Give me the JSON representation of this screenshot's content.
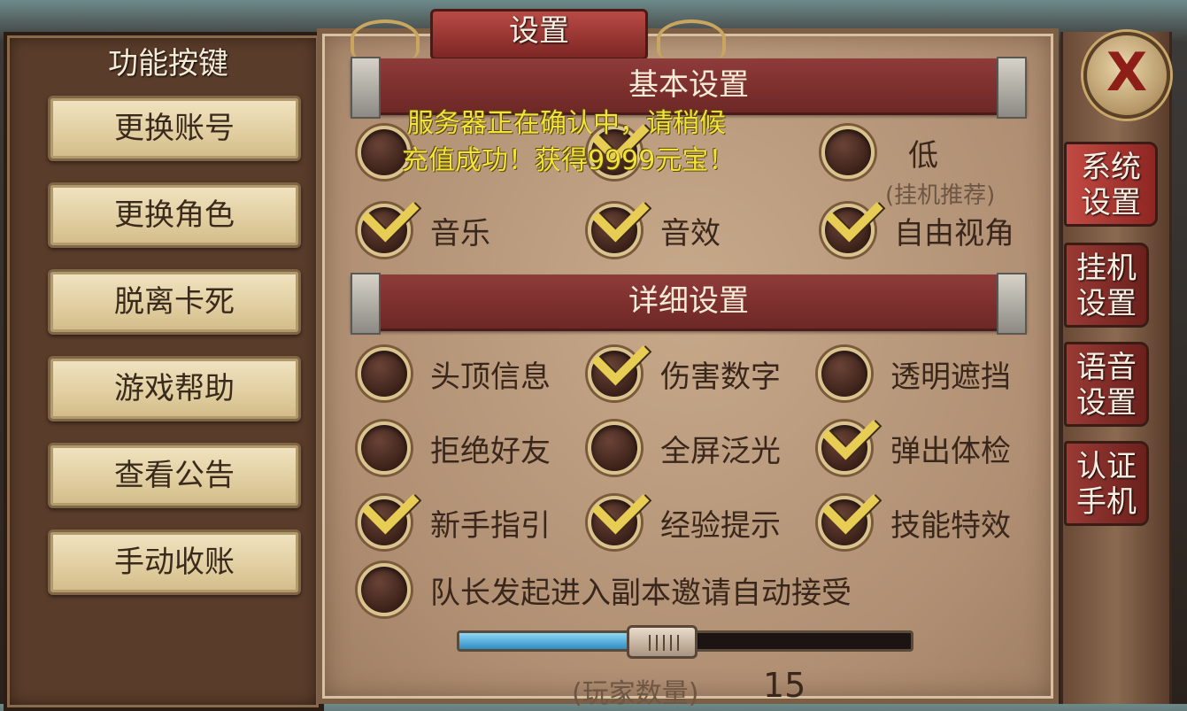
{
  "window": {
    "title": "设置"
  },
  "left_panel": {
    "title": "功能按键",
    "buttons": [
      "更换账号",
      "更换角色",
      "脱离卡死",
      "游戏帮助",
      "查看公告",
      "手动收账"
    ]
  },
  "notices": [
    "服务器正在确认中，请稍候",
    "充值成功！获得9999元宝！"
  ],
  "basic": {
    "header": "基本设置",
    "quality_low_label": "低",
    "quality_low_hint": "(挂机推荐)",
    "options": [
      {
        "label": "音乐",
        "checked": true
      },
      {
        "label": "音效",
        "checked": true
      },
      {
        "label": "自由视角",
        "checked": true
      }
    ]
  },
  "detail": {
    "header": "详细设置",
    "options": [
      {
        "label": "头顶信息",
        "checked": false
      },
      {
        "label": "伤害数字",
        "checked": true
      },
      {
        "label": "透明遮挡",
        "checked": false
      },
      {
        "label": "拒绝好友",
        "checked": false
      },
      {
        "label": "全屏泛光",
        "checked": false
      },
      {
        "label": "弹出体检",
        "checked": true
      },
      {
        "label": "新手指引",
        "checked": true
      },
      {
        "label": "经验提示",
        "checked": true
      },
      {
        "label": "技能特效",
        "checked": true
      },
      {
        "label": "队长发起进入副本邀请自动接受",
        "checked": false
      }
    ]
  },
  "player_count": {
    "label": "(玩家数量)",
    "value": "15",
    "fill_fraction": 0.45
  },
  "side_tabs": [
    {
      "label": "系统设置",
      "line1": "系统",
      "line2": "设置",
      "active": true
    },
    {
      "label": "挂机设置",
      "line1": "挂机",
      "line2": "设置",
      "active": false
    },
    {
      "label": "语音设置",
      "line1": "语音",
      "line2": "设置",
      "active": false
    },
    {
      "label": "认证手机",
      "line1": "认证",
      "line2": "手机",
      "active": false
    }
  ],
  "close_label": "X",
  "colors": {
    "accent_red": "#8e3c3a",
    "check_gold": "#e8cd54",
    "slider_blue": "#2f8ec2"
  }
}
